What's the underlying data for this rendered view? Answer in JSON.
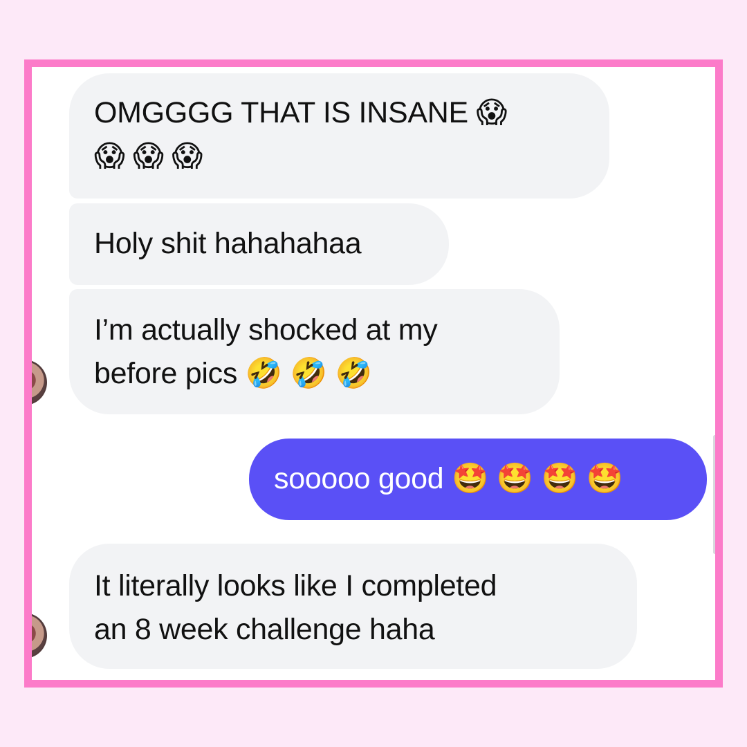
{
  "conversation": {
    "messages": [
      {
        "sender": "other",
        "text": "OMGGGG THAT IS INSANE 😱\n😱 😱 😱"
      },
      {
        "sender": "other",
        "text": "Holy shit hahahahaa"
      },
      {
        "sender": "other",
        "text": "I’m actually shocked at my\nbefore pics 🤣 🤣 🤣"
      },
      {
        "sender": "me",
        "text": "sooooo good 🤩 🤩 🤩 🤩"
      },
      {
        "sender": "other",
        "text": "It literally looks like I completed\nan 8 week challenge haha"
      }
    ]
  },
  "colors": {
    "page_background": "#fde9f8",
    "frame_border": "#fc7bc9",
    "incoming_bubble": "#f2f3f5",
    "outgoing_bubble": "#5a50f6"
  },
  "icons": {
    "avatar": "contact-avatar-photo"
  }
}
